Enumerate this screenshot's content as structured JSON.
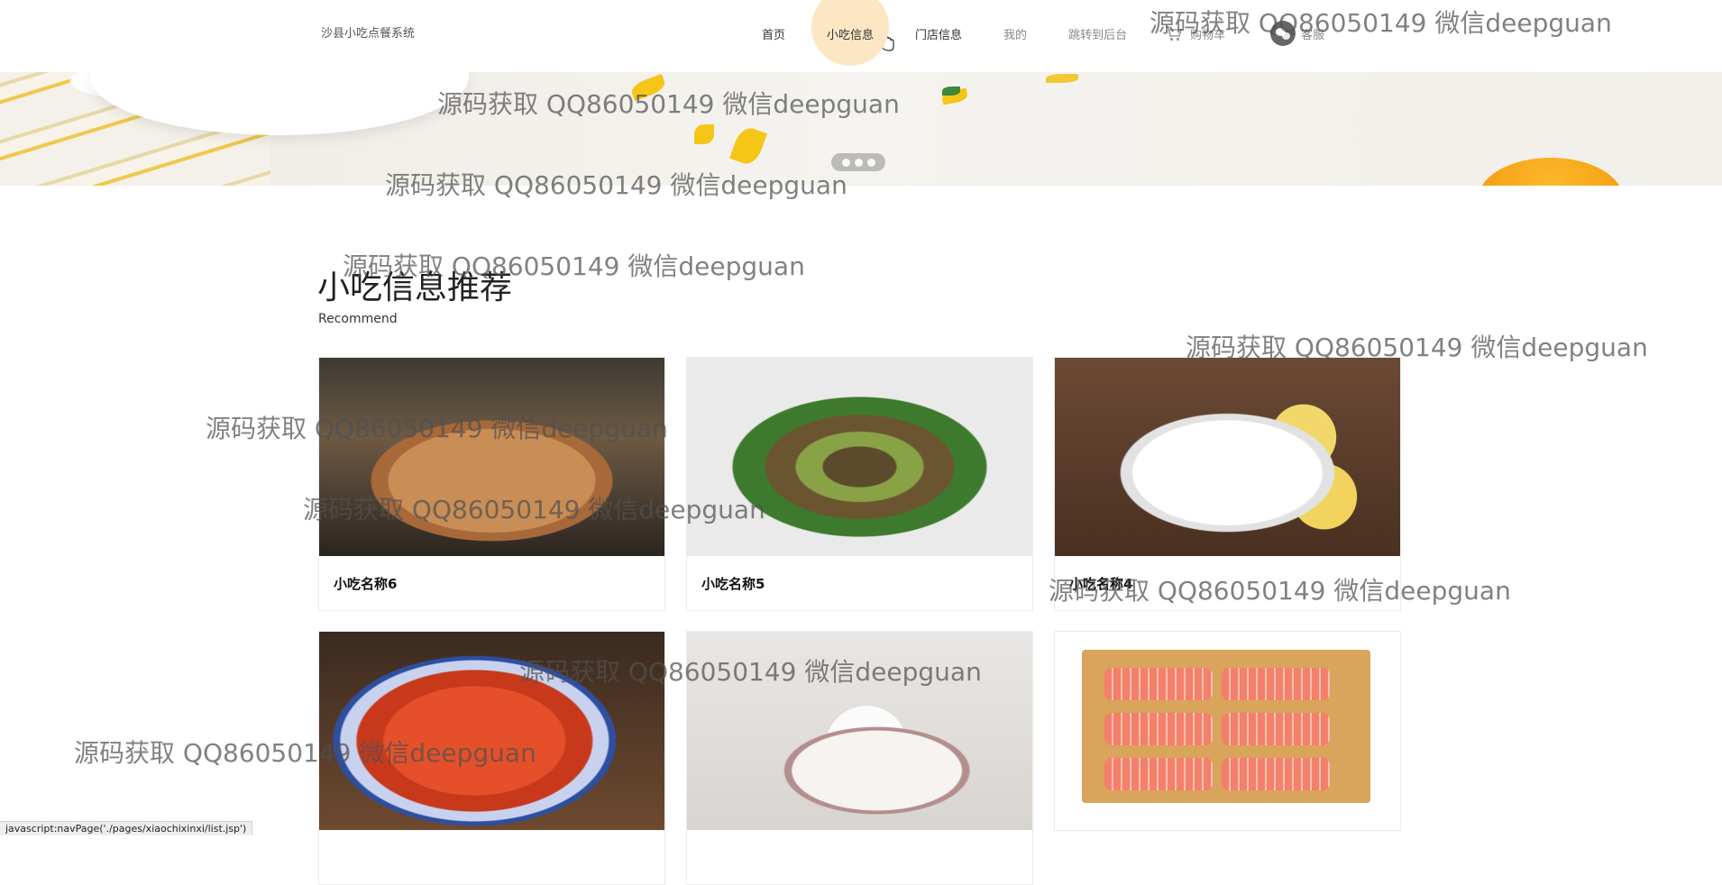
{
  "header": {
    "brand": "沙县小吃点餐系统",
    "nav": [
      {
        "label": "首页"
      },
      {
        "label": "小吃信息"
      },
      {
        "label": "门店信息"
      },
      {
        "label": "我的"
      },
      {
        "label": "跳转到后台"
      }
    ],
    "cart_label": "购物车",
    "service_label": "客服",
    "active_nav": "小吃信息"
  },
  "banner": {
    "slides_count": 3
  },
  "section": {
    "title": "小吃信息推荐",
    "subtitle": "Recommend"
  },
  "cards": [
    {
      "name": "小吃名称6"
    },
    {
      "name": "小吃名称5"
    },
    {
      "name": "小吃名称4"
    },
    {
      "name": ""
    },
    {
      "name": ""
    },
    {
      "name": ""
    }
  ],
  "watermark": "源码获取 QQ86050149 微信deepguan",
  "status_bar": "javascript:navPage('./pages/xiaochixinxi/list.jsp')",
  "colors": {
    "active_nav_bg": "#fce7c5",
    "banner_accent": "#f5c518"
  }
}
